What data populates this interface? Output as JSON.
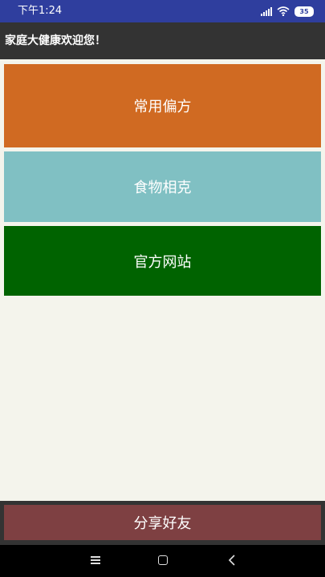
{
  "status_bar": {
    "time": "下午1:24",
    "battery_level": "35",
    "signal_icon": "signal-bars-icon",
    "wifi_icon": "wifi-icon",
    "battery_icon": "battery-icon",
    "background_color": "#2f3e9e"
  },
  "header": {
    "title": "家庭大健康欢迎您！",
    "background_color": "#333333"
  },
  "menu": {
    "items": [
      {
        "label": "常用偏方",
        "color": "#d06a22"
      },
      {
        "label": "食物相克",
        "color": "#80c0c3"
      },
      {
        "label": "官方网站",
        "color": "#006300"
      }
    ]
  },
  "footer": {
    "share_label": "分享好友",
    "share_color": "#7e4042"
  },
  "nav_bar": {
    "icons": [
      "menu-icon",
      "home-icon",
      "back-icon"
    ]
  }
}
